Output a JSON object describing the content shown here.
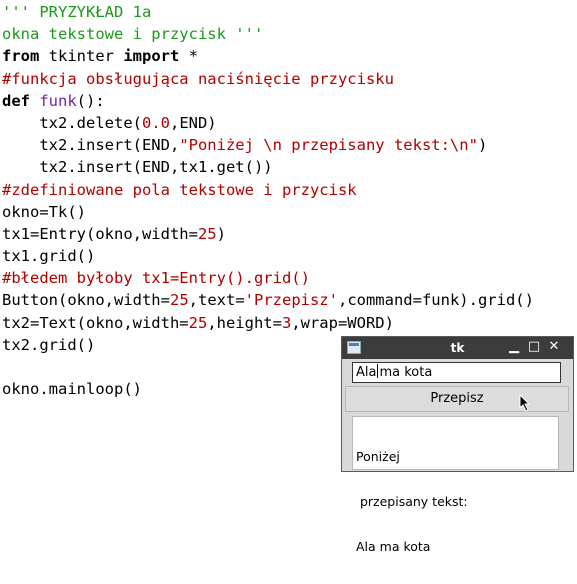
{
  "code_lines": [
    [
      {
        "t": "''' PRYZYKŁAD 1a",
        "c": "s"
      }
    ],
    [
      {
        "t": "okna tekstowe i przycisk '''",
        "c": "s"
      }
    ],
    [
      {
        "t": "from",
        "c": "k"
      },
      {
        "t": " tkinter ",
        "c": "p"
      },
      {
        "t": "import",
        "c": "k"
      },
      {
        "t": " *",
        "c": "p"
      }
    ],
    [
      {
        "t": "#funkcja obsługująca naciśnięcie przycisku",
        "c": "c"
      }
    ],
    [
      {
        "t": "def",
        "c": "k"
      },
      {
        "t": " ",
        "c": "p"
      },
      {
        "t": "funk",
        "c": "n"
      },
      {
        "t": "():",
        "c": "p"
      }
    ],
    [
      {
        "t": "    tx2.delete(",
        "c": "p"
      },
      {
        "t": "0.0",
        "c": "r"
      },
      {
        "t": ",END)",
        "c": "p"
      }
    ],
    [
      {
        "t": "    tx2.insert(END,",
        "c": "p"
      },
      {
        "t": "\"Poniżej \\n przepisany tekst:\\n\"",
        "c": "r"
      },
      {
        "t": ")",
        "c": "p"
      }
    ],
    [
      {
        "t": "    tx2.insert(END,tx1.get())",
        "c": "p"
      }
    ],
    [
      {
        "t": "#zdefiniowane pola tekstowe i przycisk",
        "c": "c"
      }
    ],
    [
      {
        "t": "okno=Tk()",
        "c": "p"
      }
    ],
    [
      {
        "t": "tx1=Entry(okno,width=",
        "c": "p"
      },
      {
        "t": "25",
        "c": "r"
      },
      {
        "t": ")",
        "c": "p"
      }
    ],
    [
      {
        "t": "tx1.grid()",
        "c": "p"
      }
    ],
    [
      {
        "t": "#błedem byłoby tx1=Entry().grid()",
        "c": "c"
      }
    ],
    [
      {
        "t": "Button(okno,width=",
        "c": "p"
      },
      {
        "t": "25",
        "c": "r"
      },
      {
        "t": ",text=",
        "c": "p"
      },
      {
        "t": "'Przepisz'",
        "c": "r"
      },
      {
        "t": ",command=funk).grid()",
        "c": "p"
      }
    ],
    [
      {
        "t": "tx2=Text(okno,width=",
        "c": "p"
      },
      {
        "t": "25",
        "c": "r"
      },
      {
        "t": ",height=",
        "c": "p"
      },
      {
        "t": "3",
        "c": "r"
      },
      {
        "t": ",wrap=WORD)",
        "c": "p"
      }
    ],
    [
      {
        "t": "tx2.grid()",
        "c": "p"
      }
    ],
    [
      {
        "t": "",
        "c": "p"
      }
    ],
    [
      {
        "t": "okno.mainloop()",
        "c": "p"
      }
    ]
  ],
  "tk_window": {
    "title": "tk",
    "app_icon": "window-icon",
    "controls": {
      "minimize": "▁",
      "maximize": "□",
      "close": "✕"
    },
    "entry_before_caret": "Ala",
    "entry_after_caret": "ma kota",
    "button_label": "Przepisz",
    "text_lines": [
      "Poniżej",
      " przepisany tekst:",
      "Ala ma kota"
    ]
  }
}
